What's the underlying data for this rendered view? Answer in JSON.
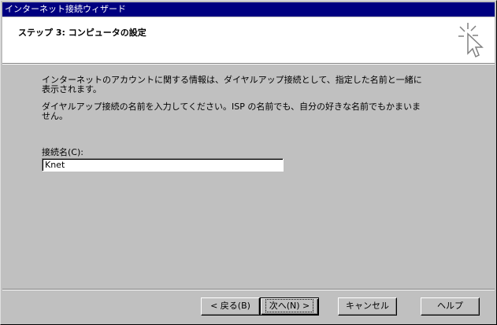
{
  "window": {
    "title": "インターネット接続ウィザード"
  },
  "header": {
    "step_title": "ステップ 3: コンピュータの設定"
  },
  "main": {
    "paragraph1": "インターネットのアカウントに関する情報は、ダイヤルアップ接続として、指定した名前と一緒に表示されます。",
    "paragraph2": "ダイヤルアップ接続の名前を入力してください。ISP の名前でも、自分の好きな名前でもかまいません。",
    "connection_name_label": "接続名(C):",
    "connection_name_value": "Knet"
  },
  "buttons": {
    "back": "< 戻る(B)",
    "next": "次へ(N) >",
    "cancel": "キャンセル",
    "help": "ヘルプ"
  },
  "colors": {
    "titlebar": "#000080",
    "face": "#c0c0c0",
    "header_bg": "#ffffff"
  },
  "icons": {
    "header": "wizard-pointer-icon"
  }
}
